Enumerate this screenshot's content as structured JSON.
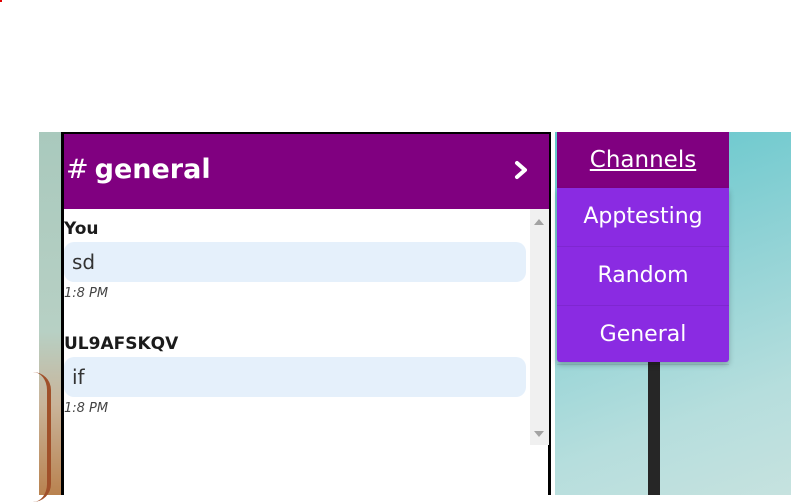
{
  "chat": {
    "channel_hash": "#",
    "channel_name": "general",
    "messages": [
      {
        "author": "You",
        "text": "sd",
        "time": "1:8 PM"
      },
      {
        "author": "UL9AFSKQV",
        "text": "if",
        "time": "1:8 PM"
      }
    ]
  },
  "channels": {
    "header": "Channels",
    "items": [
      "Apptesting",
      "Random",
      "General"
    ]
  },
  "icons": {
    "expand": "chevron-right-icon",
    "scroll_up": "scroll-up-arrow-icon",
    "scroll_down": "scroll-down-arrow-icon"
  },
  "colors": {
    "header_purple": "#800080",
    "menu_violet": "#8a2be2",
    "bubble": "#e5f0fb"
  }
}
